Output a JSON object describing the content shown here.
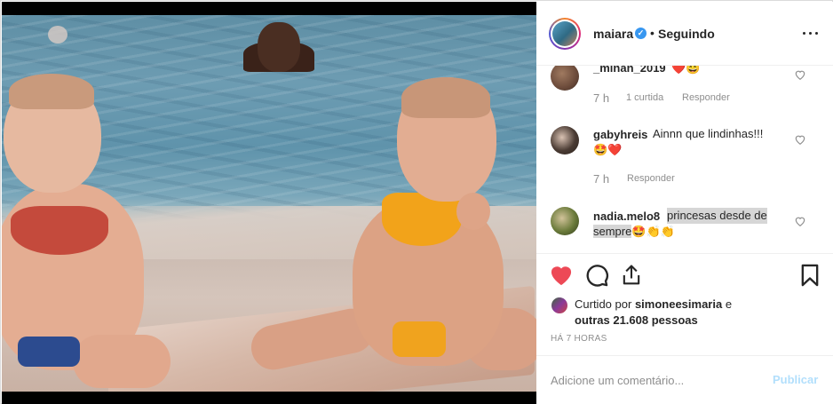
{
  "header": {
    "username": "maiara",
    "verified_icon": "verified-badge-icon",
    "dot": "•",
    "follow_status": "Seguindo",
    "more_icon": "more-options-icon"
  },
  "comments": [
    {
      "username": "_minan_2019",
      "text": "",
      "emojis": "❤️😄",
      "time": "7 h",
      "likes": "1 curtida",
      "reply": "Responder",
      "avatar_color": "#6b4a3a"
    },
    {
      "username": "gabyhreis",
      "text": "Ainnn que lindinhas!!!",
      "emojis": "🤩❤️",
      "time": "7 h",
      "likes": "",
      "reply": "Responder",
      "avatar_color": "#4a3b33"
    },
    {
      "username": "nadia.melo8",
      "text_part1": "princesas desde de",
      "text_part2": "sempre",
      "emojis": "🤩👏👏",
      "avatar_color": "#6a7a3a"
    }
  ],
  "actions": {
    "like_icon": "heart-filled-icon",
    "comment_icon": "comment-bubble-icon",
    "share_icon": "share-icon",
    "save_icon": "bookmark-icon",
    "like_color": "#ed4956"
  },
  "likes": {
    "prefix": "Curtido por",
    "user": "simoneesimaria",
    "connector": "e",
    "others": "outras 21.608 pessoas"
  },
  "time_ago": "HÁ 7 HORAS",
  "add_comment": {
    "placeholder": "Adicione um comentário...",
    "publish": "Publicar"
  },
  "colors": {
    "text": "#262626",
    "muted": "#8e8e8e",
    "verified": "#3897f0",
    "publish_disabled": "#b2dffc"
  }
}
